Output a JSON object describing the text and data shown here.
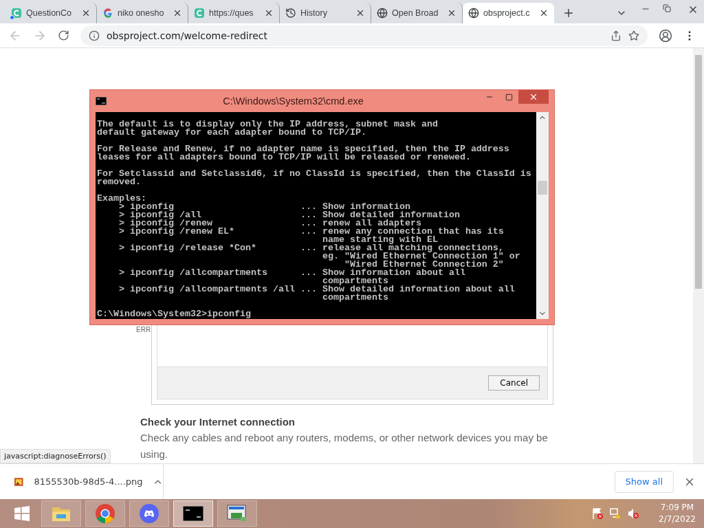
{
  "browser": {
    "tabs": [
      {
        "title": "QuestionCo",
        "kind": "c-logo",
        "notification": true,
        "selected": false
      },
      {
        "title": "niko onesho",
        "kind": "google",
        "notification": false,
        "selected": false
      },
      {
        "title": "https://ques",
        "kind": "c-logo",
        "notification": false,
        "selected": false
      },
      {
        "title": "History",
        "kind": "history",
        "notification": false,
        "selected": false
      },
      {
        "title": "Open Broad",
        "kind": "globe",
        "notification": false,
        "selected": false
      },
      {
        "title": "obsproject.c",
        "kind": "globe",
        "notification": false,
        "selected": true
      }
    ],
    "nav": {
      "back_disabled": true,
      "forward_disabled": true
    },
    "url": "obsproject.com/welcome-redirect"
  },
  "page": {
    "error_code": "ERR",
    "dialog": {
      "button": "Cancel"
    },
    "heading": "Check your Internet connection",
    "text": "Check any cables and reboot any routers, modems, or other network devices you may be using.",
    "status": "javascript:diagnoseErrors()"
  },
  "console": {
    "title": "C:\\Windows\\System32\\cmd.exe",
    "paragraphs": [
      [
        "The default is to display only the IP address, subnet mask and",
        "default gateway for each adapter bound to TCP/IP."
      ],
      [
        "For Release and Renew, if no adapter name is specified, then the IP address",
        "leases for all adapters bound to TCP/IP will be released or renewed."
      ],
      [
        "For Setclassid and Setclassid6, if no ClassId is specified, then the ClassId is",
        "removed."
      ],
      [
        "Examples:",
        "    > ipconfig                       ... Show information",
        "    > ipconfig /all                  ... Show detailed information",
        "    > ipconfig /renew                ... renew all adapters",
        "    > ipconfig /renew EL*            ... renew any connection that has its",
        "                                         name starting with EL",
        "    > ipconfig /release *Con*        ... release all matching connections,",
        "                                         eg. \"Wired Ethernet Connection 1\" or",
        "                                             \"Wired Ethernet Connection 2\"",
        "    > ipconfig /allcompartments      ... Show information about all",
        "                                         compartments",
        "    > ipconfig /allcompartments /all ... Show detailed information about all",
        "                                         compartments"
      ]
    ],
    "prompt": "C:\\Windows\\System32>ipconfig"
  },
  "downloads": {
    "file": "8155530b-98d5-4....png",
    "show_all": "Show all"
  },
  "taskbar": {
    "apps": [
      {
        "kind": "explorer",
        "selected": false
      },
      {
        "kind": "chrome",
        "selected": false
      },
      {
        "kind": "discord",
        "selected": false
      },
      {
        "kind": "cmd",
        "selected": true
      },
      {
        "kind": "network",
        "selected": false
      }
    ],
    "time": "7:09 PM",
    "date": "2/7/2022"
  }
}
